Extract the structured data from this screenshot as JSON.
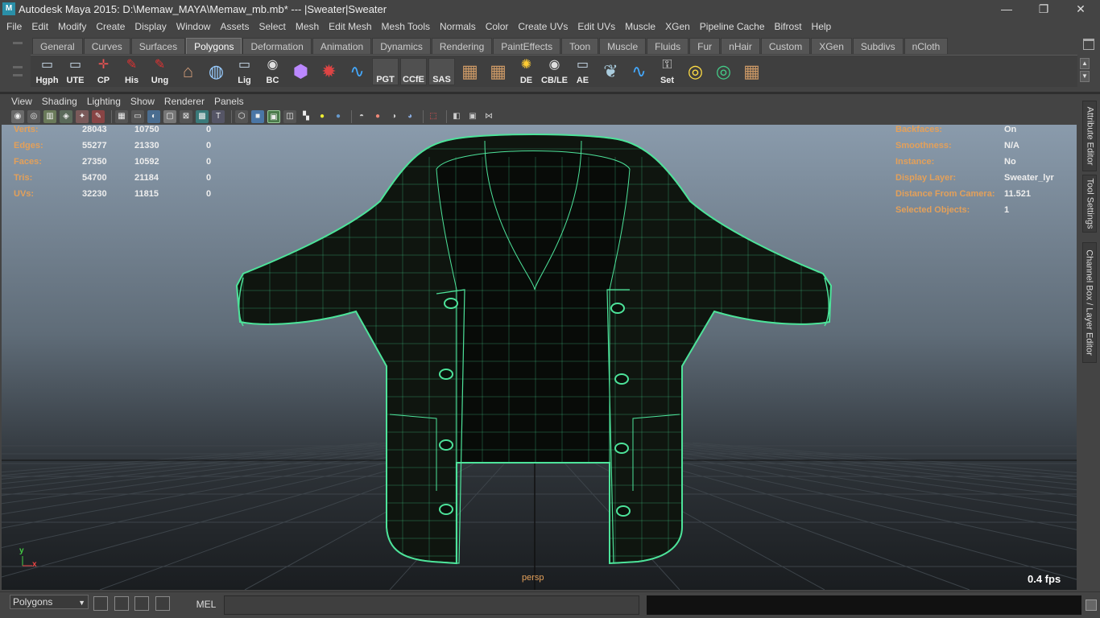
{
  "window": {
    "title": "Autodesk Maya 2015: D:\\Memaw_MAYA\\Memaw_mb.mb*   ---   |Sweater|Sweater",
    "app_icon_text": "M",
    "controls": [
      "—",
      "❐",
      "✕"
    ]
  },
  "menubar": [
    "File",
    "Edit",
    "Modify",
    "Create",
    "Display",
    "Window",
    "Assets",
    "Select",
    "Mesh",
    "Edit Mesh",
    "Mesh Tools",
    "Normals",
    "Color",
    "Create UVs",
    "Edit UVs",
    "Muscle",
    "XGen",
    "Pipeline Cache",
    "Bifrost",
    "Help"
  ],
  "shelf": {
    "tabs": [
      "General",
      "Curves",
      "Surfaces",
      "Polygons",
      "Deformation",
      "Animation",
      "Dynamics",
      "Rendering",
      "PaintEffects",
      "Toon",
      "Muscle",
      "Fluids",
      "Fur",
      "nHair",
      "Custom",
      "XGen",
      "Subdivs",
      "nCloth"
    ],
    "active_tab": "Polygons",
    "icons": [
      {
        "label": "Hgph",
        "icon": "window-icon"
      },
      {
        "label": "UTE",
        "icon": "window-icon"
      },
      {
        "label": "CP",
        "icon": "axis-icon"
      },
      {
        "label": "His",
        "icon": "paper-pen-icon"
      },
      {
        "label": "Ung",
        "icon": "paper-pen-icon"
      },
      {
        "label": "",
        "icon": "brush-icon"
      },
      {
        "label": "",
        "icon": "globe-search-icon"
      },
      {
        "label": "Lig",
        "icon": "window-icon"
      },
      {
        "label": "BC",
        "icon": "eye-icon"
      },
      {
        "label": "",
        "icon": "cube-frame-icon"
      },
      {
        "label": "",
        "icon": "camera-icon"
      },
      {
        "label": "",
        "icon": "curve-icon"
      },
      {
        "label": "PGT",
        "icon": "blank-icon"
      },
      {
        "label": "CCfE",
        "icon": "blank-icon"
      },
      {
        "label": "SAS",
        "icon": "blank-icon"
      },
      {
        "label": "",
        "icon": "uv-icon"
      },
      {
        "label": "",
        "icon": "uv-icon"
      },
      {
        "label": "DE",
        "icon": "light-icon"
      },
      {
        "label": "CB/LE",
        "icon": "eye-icon"
      },
      {
        "label": "AE",
        "icon": "window-icon"
      },
      {
        "label": "",
        "icon": "shell-icon"
      },
      {
        "label": "",
        "icon": "curve-icon"
      },
      {
        "label": "Set",
        "icon": "key-icon"
      },
      {
        "label": "",
        "icon": "target-icon"
      },
      {
        "label": "",
        "icon": "color-target-icon"
      },
      {
        "label": "",
        "icon": "uv-icon"
      }
    ]
  },
  "panel": {
    "menus": [
      "View",
      "Shading",
      "Lighting",
      "Show",
      "Renderer",
      "Panels"
    ],
    "camera_label": "persp",
    "fps": "0.4 fps",
    "axis": {
      "y": "y",
      "x": "x"
    }
  },
  "hud_left": {
    "rows": [
      {
        "label": "Verts:",
        "v1": "28043",
        "v2": "10750",
        "v3": "0"
      },
      {
        "label": "Edges:",
        "v1": "55277",
        "v2": "21330",
        "v3": "0"
      },
      {
        "label": "Faces:",
        "v1": "27350",
        "v2": "10592",
        "v3": "0"
      },
      {
        "label": "Tris:",
        "v1": "54700",
        "v2": "21184",
        "v3": "0"
      },
      {
        "label": "UVs:",
        "v1": "32230",
        "v2": "11815",
        "v3": "0"
      }
    ]
  },
  "hud_right": {
    "rows": [
      {
        "label": "Backfaces:",
        "value": "On"
      },
      {
        "label": "Smoothness:",
        "value": "N/A"
      },
      {
        "label": "Instance:",
        "value": "No"
      },
      {
        "label": "Display Layer:",
        "value": "Sweater_lyr"
      },
      {
        "label": "Distance From Camera:",
        "value": "11.521"
      },
      {
        "label": "Selected Objects:",
        "value": "1"
      }
    ]
  },
  "right_dock_tabs": [
    "Attribute Editor",
    "Tool Settings",
    "Channel Box / Layer Editor"
  ],
  "command_line": {
    "mode": "Polygons",
    "language": "MEL",
    "input_value": "",
    "output_value": ""
  },
  "colors": {
    "wire": "#4de39a",
    "hud_label": "#e3a05a",
    "hud_value": "#eeeeee",
    "ui_bg": "#444444"
  }
}
